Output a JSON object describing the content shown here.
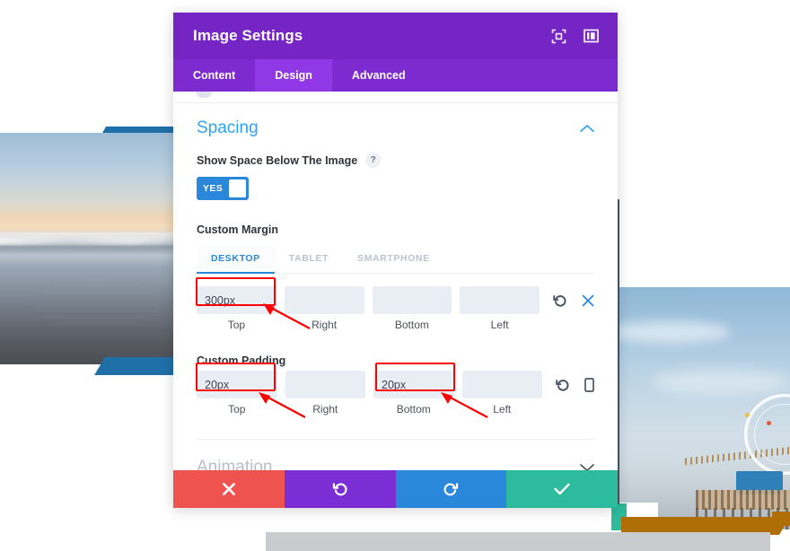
{
  "modal": {
    "title": "Image Settings",
    "title_icons": [
      {
        "name": "focus-icon"
      },
      {
        "name": "layout-panel-icon"
      }
    ],
    "tabs": [
      {
        "label": "Content",
        "active": false
      },
      {
        "label": "Design",
        "active": true
      },
      {
        "label": "Advanced",
        "active": false
      }
    ],
    "sections": {
      "spacing": {
        "title": "Spacing",
        "collapsed": false,
        "chevron": "chevron-up",
        "show_space_label": "Show Space Below The Image",
        "help_glyph": "?",
        "toggle_value": "YES",
        "custom_margin": {
          "label": "Custom Margin",
          "device_tabs": [
            {
              "label": "DESKTOP",
              "active": true
            },
            {
              "label": "TABLET",
              "active": false
            },
            {
              "label": "SMARTPHONE",
              "active": false
            }
          ],
          "fields": [
            {
              "caption": "Top",
              "value": "300px",
              "highlighted": true
            },
            {
              "caption": "Right",
              "value": "",
              "highlighted": false
            },
            {
              "caption": "Bottom",
              "value": "",
              "highlighted": false
            },
            {
              "caption": "Left",
              "value": "",
              "highlighted": false
            }
          ],
          "actions": [
            {
              "name": "reset-icon"
            },
            {
              "name": "close-icon"
            }
          ]
        },
        "custom_padding": {
          "label": "Custom Padding",
          "fields": [
            {
              "caption": "Top",
              "value": "20px",
              "highlighted": true
            },
            {
              "caption": "Right",
              "value": "",
              "highlighted": false
            },
            {
              "caption": "Bottom",
              "value": "20px",
              "highlighted": true
            },
            {
              "caption": "Left",
              "value": "",
              "highlighted": false
            }
          ],
          "actions": [
            {
              "name": "reset-icon"
            },
            {
              "name": "mobile-device-icon"
            }
          ]
        }
      },
      "animation": {
        "title": "Animation",
        "collapsed": true,
        "chevron": "chevron-down"
      }
    },
    "footer": [
      {
        "name": "cancel-button",
        "glyph": "✖",
        "color": "#ef5350"
      },
      {
        "name": "undo-button",
        "glyph": "↺",
        "color": "#7a2ed4"
      },
      {
        "name": "redo-button",
        "glyph": "↻",
        "color": "#2b87da"
      },
      {
        "name": "save-button",
        "glyph": "✔",
        "color": "#2dbb9d"
      }
    ]
  },
  "annotations": {
    "color": "#ff0000",
    "boxes": [
      {
        "name": "margin-top-highlight"
      },
      {
        "name": "padding-top-highlight"
      },
      {
        "name": "padding-bottom-highlight"
      }
    ],
    "arrows": [
      {
        "name": "arrow-to-margin-top"
      },
      {
        "name": "arrow-to-padding-top"
      },
      {
        "name": "arrow-to-padding-bottom"
      }
    ]
  },
  "background": {
    "left_image": {
      "name": "beach-sunset-photo"
    },
    "right_image": {
      "name": "pier-ferris-wheel-photo"
    },
    "accent_blue": "#1f6fa8",
    "accent_orange": "#b06f06",
    "accent_teal": "#2dbb9d"
  }
}
